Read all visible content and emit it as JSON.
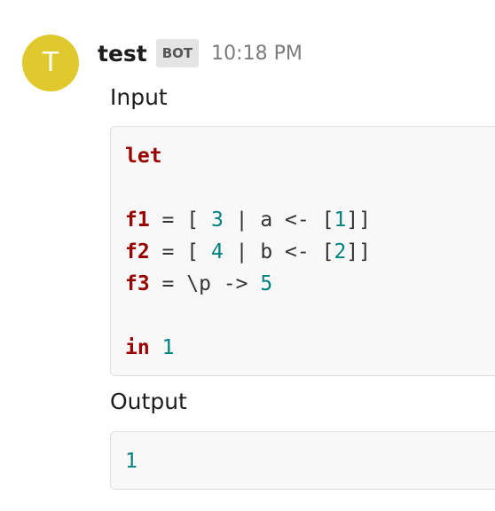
{
  "message": {
    "avatar_letter": "T",
    "username": "test",
    "badge": "BOT",
    "time": "10:18 PM"
  },
  "input": {
    "label": "Input",
    "lines": [
      [
        {
          "t": "let",
          "c": "kw"
        }
      ],
      [],
      [
        {
          "t": "f1",
          "c": "kw"
        },
        {
          "t": " = [ ",
          "c": "op"
        },
        {
          "t": "3",
          "c": "num"
        },
        {
          "t": " | a <- [",
          "c": "op"
        },
        {
          "t": "1",
          "c": "num"
        },
        {
          "t": "]]",
          "c": "op"
        }
      ],
      [
        {
          "t": "f2",
          "c": "kw"
        },
        {
          "t": " = [ ",
          "c": "op"
        },
        {
          "t": "4",
          "c": "num"
        },
        {
          "t": " | b <- [",
          "c": "op"
        },
        {
          "t": "2",
          "c": "num"
        },
        {
          "t": "]]",
          "c": "op"
        }
      ],
      [
        {
          "t": "f3",
          "c": "kw"
        },
        {
          "t": " = \\p -> ",
          "c": "op"
        },
        {
          "t": "5",
          "c": "num"
        }
      ],
      [],
      [
        {
          "t": "in",
          "c": "kw"
        },
        {
          "t": " ",
          "c": "op"
        },
        {
          "t": "1",
          "c": "num"
        }
      ]
    ]
  },
  "output": {
    "label": "Output",
    "lines": [
      [
        {
          "t": "1",
          "c": "num"
        }
      ]
    ]
  },
  "colors": {
    "avatar": "#e0c92e",
    "keyword": "#990000",
    "number": "#00807f"
  }
}
